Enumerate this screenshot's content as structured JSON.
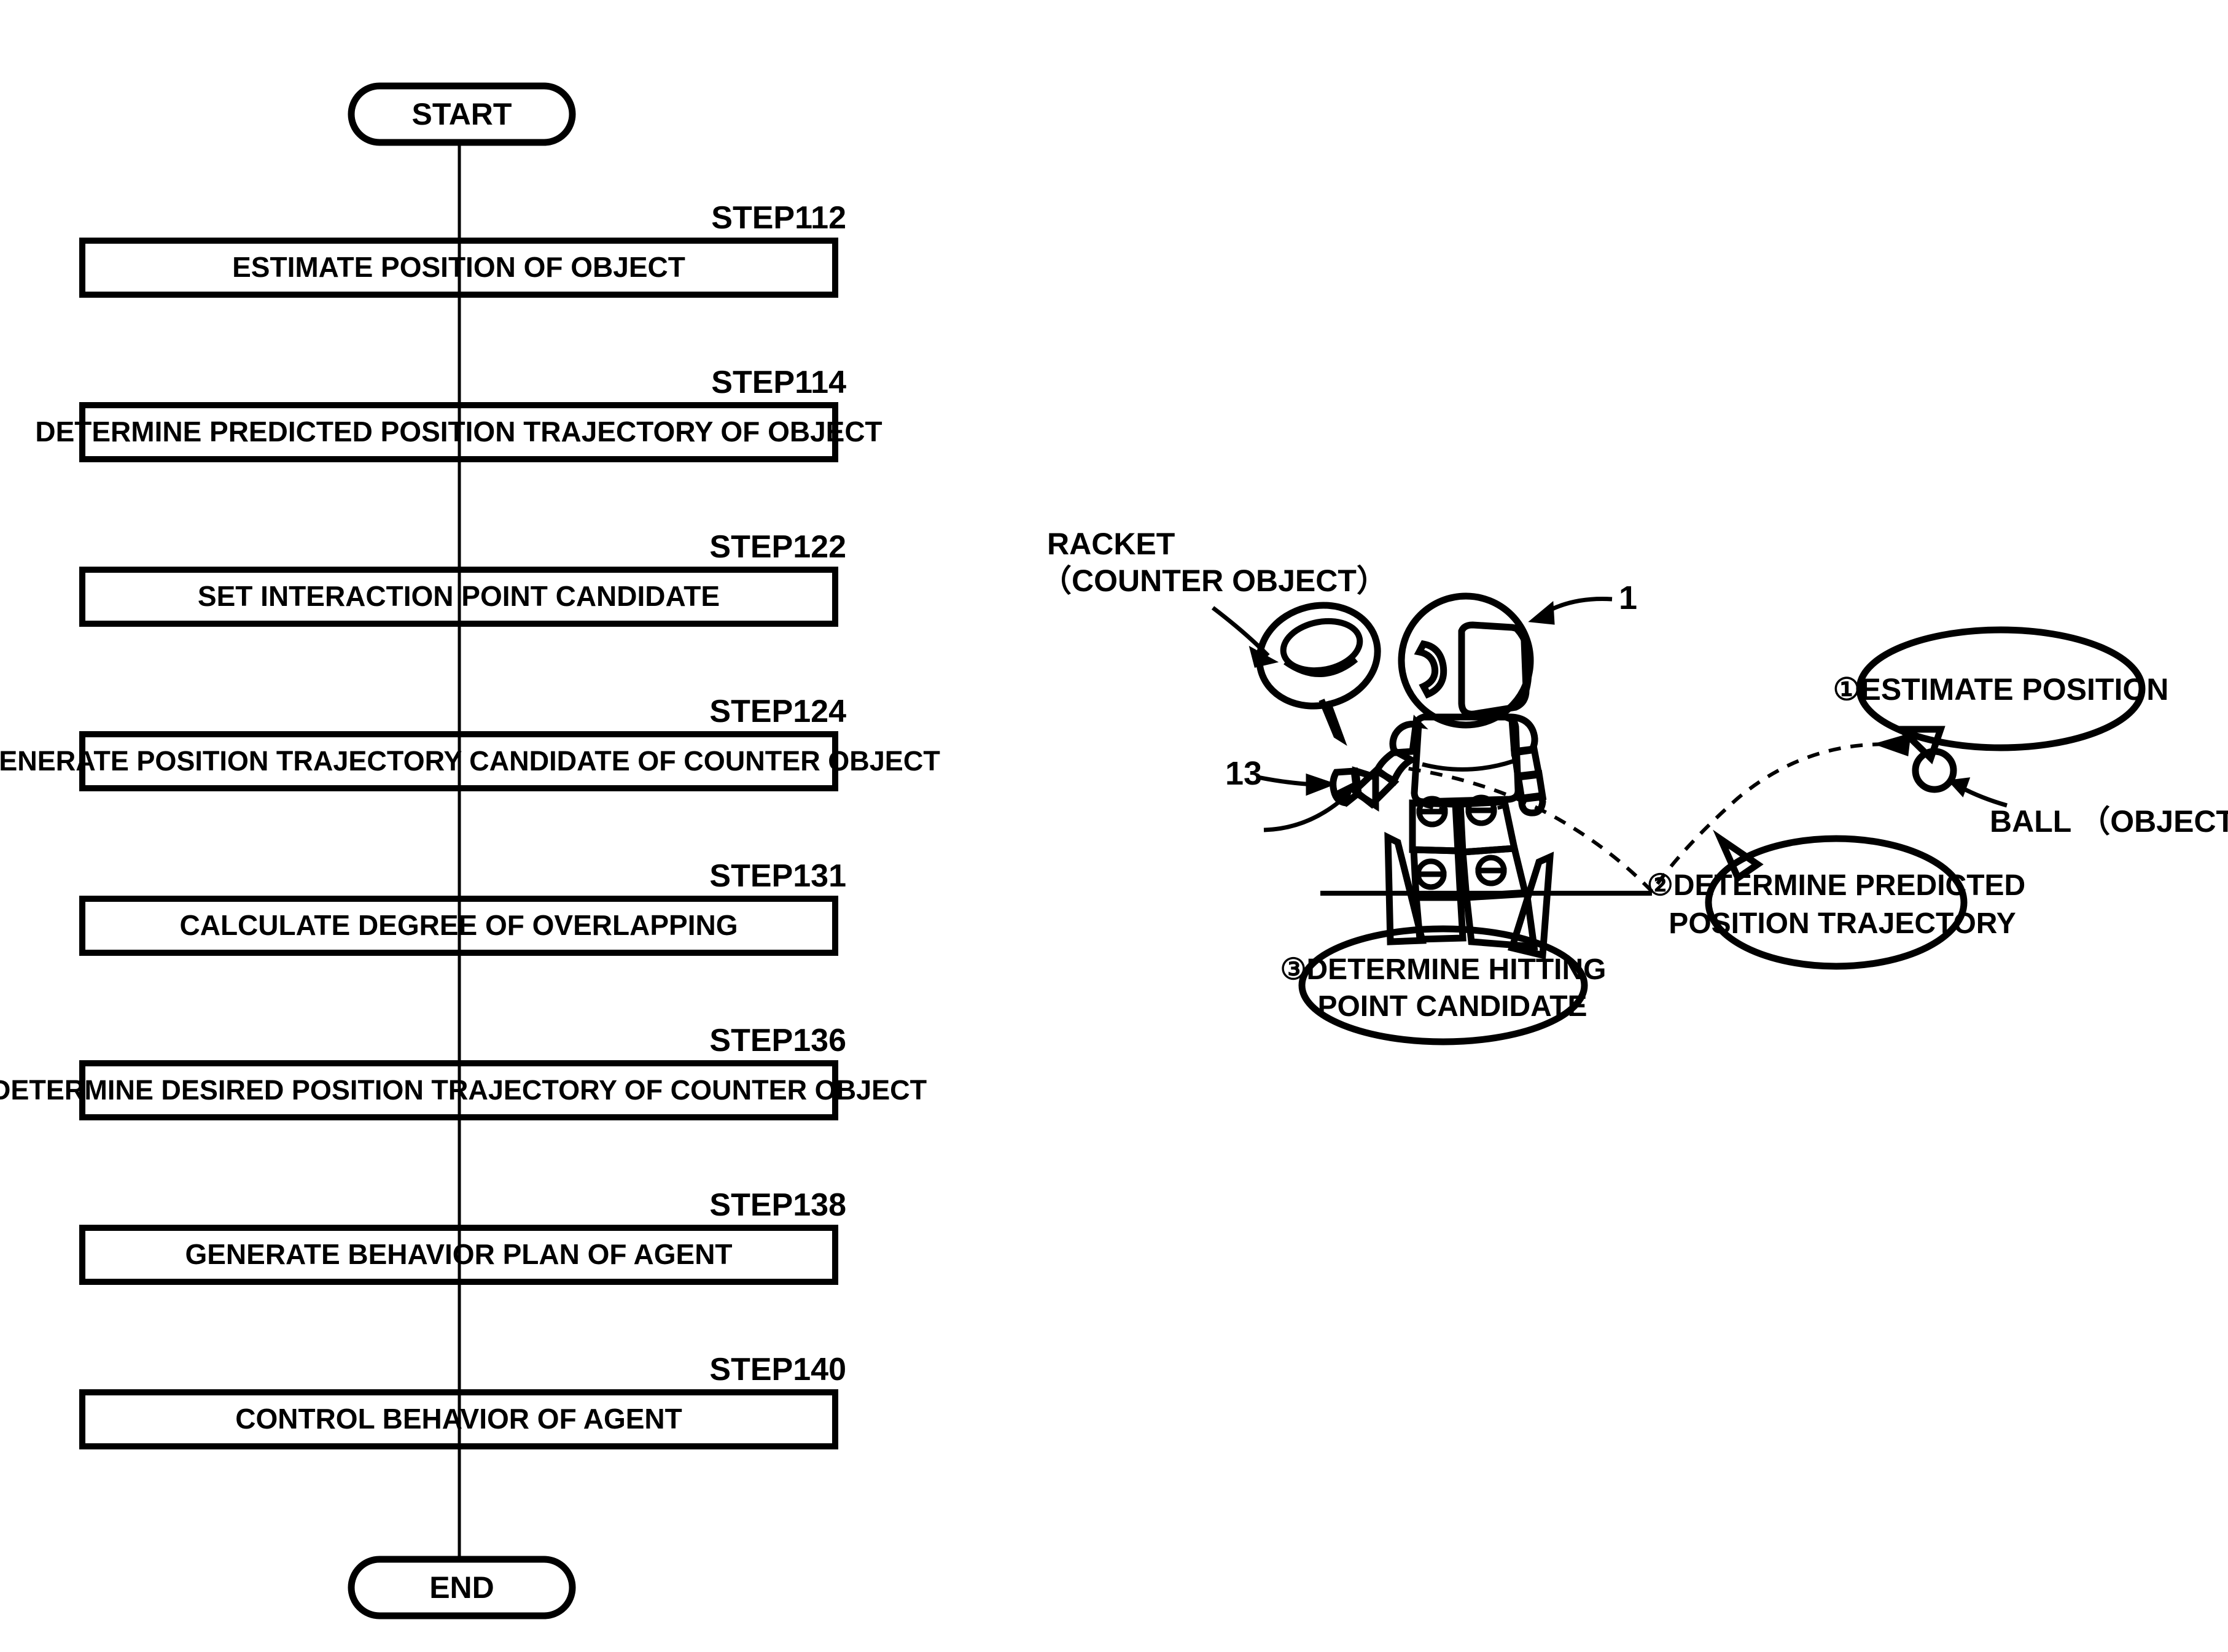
{
  "figure": {
    "type": "patent-flowchart-with-illustration",
    "background_color": "#ffffff",
    "line_color": "#000000"
  },
  "flowchart": {
    "start_label": "START",
    "end_label": "END",
    "steps": [
      {
        "id": "STEP112",
        "label": "ESTIMATE POSITION OF OBJECT"
      },
      {
        "id": "STEP114",
        "label": "DETERMINE PREDICTED POSITION TRAJECTORY OF OBJECT"
      },
      {
        "id": "STEP122",
        "label": "SET INTERACTION POINT CANDIDATE"
      },
      {
        "id": "STEP124",
        "label": "GENERATE POSITION TRAJECTORY CANDIDATE OF COUNTER OBJECT"
      },
      {
        "id": "STEP131",
        "label": "CALCULATE DEGREE OF OVERLAPPING"
      },
      {
        "id": "STEP136",
        "label": "DETERMINE DESIRED POSITION TRAJECTORY OF COUNTER OBJECT"
      },
      {
        "id": "STEP138",
        "label": "GENERATE BEHAVIOR PLAN OF AGENT"
      },
      {
        "id": "STEP140",
        "label": "CONTROL BEHAVIOR OF AGENT"
      }
    ]
  },
  "illustration": {
    "labels": {
      "racket_line1": "RACKET",
      "racket_line2": "（COUNTER OBJECT）",
      "hand_ref": "13",
      "robot_ref": "1",
      "ball": "BALL （OBJECT）"
    },
    "callouts": [
      {
        "marker": "①",
        "line1": "ESTIMATE POSITION",
        "line2": ""
      },
      {
        "marker": "②",
        "line1": "DETERMINE PREDICTED",
        "line2": "POSITION TRAJECTORY"
      },
      {
        "marker": "③",
        "line1": "DETERMINE HITTING",
        "line2": "POINT CANDIDATE"
      }
    ]
  }
}
